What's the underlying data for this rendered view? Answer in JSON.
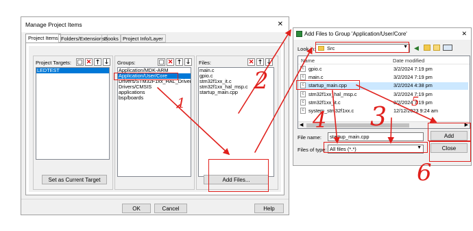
{
  "manage": {
    "title": "Manage Project Items",
    "close_glyph": "✕",
    "tabs": [
      "Project Items",
      "Folders/Extensions",
      "Books",
      "Project Info/Layer"
    ],
    "targets_label": "Project Targets:",
    "groups_label": "Groups:",
    "files_label": "Files:",
    "targets": [
      "LEDTEST"
    ],
    "groups": [
      "Application/MDK-ARM",
      "Application/User/Core",
      "Drivers/STM32F1xx_HAL_Driver",
      "Drivers/CMSIS",
      "applications",
      "bsp/boards"
    ],
    "files": [
      "main.c",
      "gpio.c",
      "stm32f1xx_it.c",
      "stm32f1xx_hal_msp.c",
      "startup_main.cpp"
    ],
    "set_current_target_label": "Set as Current Target",
    "add_files_label": "Add Files...",
    "ok_label": "OK",
    "cancel_label": "Cancel",
    "help_label": "Help"
  },
  "addfiles": {
    "title": "Add Files to Group 'Application/User/Core'",
    "close_glyph": "✕",
    "look_in_label": "Look in:",
    "look_in_value": "Src",
    "columns": {
      "name": "Name",
      "date": "Date modified"
    },
    "files": [
      {
        "name": "gpio.c",
        "date": "3/2/2024 7:19 pm"
      },
      {
        "name": "main.c",
        "date": "3/2/2024 7:19 pm"
      },
      {
        "name": "startup_main.cpp",
        "date": "3/2/2024 4:38 pm"
      },
      {
        "name": "stm32f1xx_hal_msp.c",
        "date": "3/2/2024 7:19 pm"
      },
      {
        "name": "stm32f1xx_it.c",
        "date": "3/2/2024 7:19 pm"
      },
      {
        "name": "system_stm32f1xx.c",
        "date": "12/12/2023 9:24 am"
      }
    ],
    "file_name_label": "File name:",
    "file_name_value": "startup_main.cpp",
    "files_of_type_label": "Files of type:",
    "files_of_type_value": "All files (*.*)",
    "add_label": "Add",
    "close_label": "Close"
  },
  "annotations": [
    "1",
    "2",
    "3",
    "4",
    "5",
    "6"
  ],
  "colors": {
    "selection": "#0078d7",
    "annotation": "#e0201c",
    "dialog_bg": "#f0f0f0"
  }
}
